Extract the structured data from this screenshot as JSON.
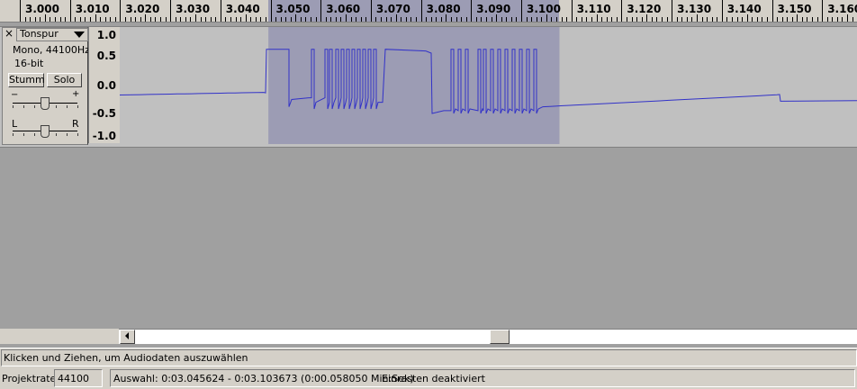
{
  "ruler": {
    "ticks": [
      "3.000",
      "3.010",
      "3.020",
      "3.030",
      "3.040",
      "3.050",
      "3.060",
      "3.070",
      "3.080",
      "3.090",
      "3.100",
      "3.110",
      "3.120",
      "3.130",
      "3.140",
      "3.150",
      "3.160"
    ],
    "selection_start": 3.045624,
    "selection_end": 3.103673
  },
  "track": {
    "close_label": "×",
    "name": "Tonspur",
    "format": "Mono, 44100Hz",
    "bitdepth": "16-bit",
    "mute_label": "Stumm",
    "solo_label": "Solo",
    "gain_minus": "−",
    "gain_plus": "+",
    "pan_left": "L",
    "pan_right": "R",
    "scale": [
      "1.0",
      "0.5",
      "0.0",
      "-0.5",
      "-1.0"
    ],
    "wave_color": "#3232c8",
    "selection_color": "#9c9cb4"
  },
  "status": {
    "hint": "Klicken und Ziehen, um Audiodaten auszuwählen",
    "rate_label": "Projektrate:",
    "rate_value": "44100",
    "selection_text": "Auswahl: 0:03.045624 - 0:03.103673 (0:00.058050 Min:Sek)",
    "snap_text": "Einrasten deaktiviert"
  }
}
